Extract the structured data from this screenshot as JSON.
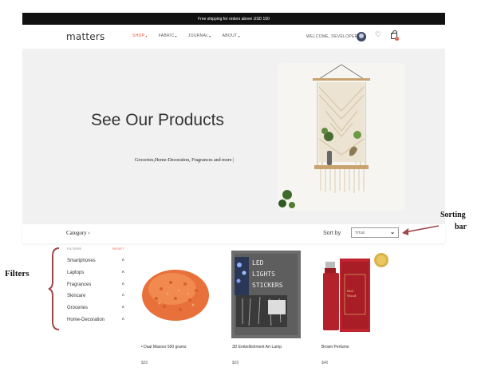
{
  "promo": {
    "text": "Free shipping for orders above USD 150"
  },
  "header": {
    "logo": "matters",
    "nav": [
      {
        "label": "SHOP",
        "active": true
      },
      {
        "label": "FABRIC",
        "active": false
      },
      {
        "label": "JOURNAL",
        "active": false
      },
      {
        "label": "ABOUT",
        "active": false
      }
    ],
    "welcome": "WELCOME, DEVELOPER",
    "cart_count": "0"
  },
  "hero": {
    "title": "See Our Products",
    "subtitle": "Groceries,Home-Decoration, Fragrances and more"
  },
  "toolbar": {
    "category_label": "Category",
    "sort_label": "Sort by",
    "sort_value": "TITLE"
  },
  "filters": {
    "heading": "FILTERS",
    "reset": "RESET",
    "items": [
      "Smartphones",
      "Laptops",
      "Fragrances",
      "Skincare",
      "Groceries",
      "Home-Decoration"
    ]
  },
  "products": [
    {
      "name": "Daal Masoor 500 grams",
      "price": "$20"
    },
    {
      "name": "3D Embellishment Art Lamp",
      "price": "$20"
    },
    {
      "name": "Brown Perfume",
      "price": "$40"
    }
  ],
  "annotations": {
    "sorting": "Sorting",
    "sorting2": "bar",
    "filters": "Filters"
  },
  "lamp_text": [
    "LED",
    "LIGHTS",
    "STICKERS"
  ],
  "colors": {
    "accent": "#e5533d",
    "promo_bg": "#111111",
    "hero_bg": "#f1f1f1",
    "annotation": "#a0454b"
  }
}
